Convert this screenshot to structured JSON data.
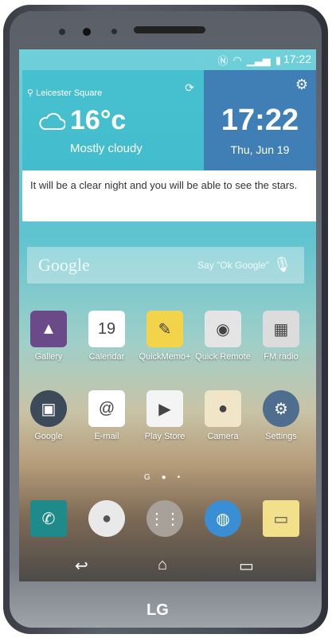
{
  "status": {
    "time": "17:22"
  },
  "weather": {
    "location": "Leicester Square",
    "temperature": "16°c",
    "condition": "Mostly cloudy"
  },
  "clock_widget": {
    "time": "17:22",
    "date": "Thu, Jun 19"
  },
  "notification": {
    "text": "It will be a clear night and you will be able to see the stars."
  },
  "search": {
    "logo": "Google",
    "hint": "Say \"Ok Google\""
  },
  "apps_row1": [
    {
      "label": "Gallery",
      "icon": "gallery-icon",
      "glyph": "▲",
      "bg": "#6b4a8a"
    },
    {
      "label": "Calendar",
      "icon": "calendar-icon",
      "glyph": "19",
      "bg": "#ffffff"
    },
    {
      "label": "QuickMemo+",
      "icon": "quickmemo-icon",
      "glyph": "✎",
      "bg": "#f3d34a"
    },
    {
      "label": "Quick Remote",
      "icon": "remote-icon",
      "glyph": "◉",
      "bg": "#e4e4e4"
    },
    {
      "label": "FM radio",
      "icon": "radio-icon",
      "glyph": "▦",
      "bg": "#dcdcdc"
    }
  ],
  "apps_row2": [
    {
      "label": "Google",
      "icon": "google-folder-icon",
      "glyph": "▣",
      "bg": "#3c4a5a"
    },
    {
      "label": "E-mail",
      "icon": "email-icon",
      "glyph": "@",
      "bg": "#ffffff"
    },
    {
      "label": "Play Store",
      "icon": "play-store-icon",
      "glyph": "▶",
      "bg": "#f4f4f4"
    },
    {
      "label": "Camera",
      "icon": "camera-icon",
      "glyph": "●",
      "bg": "#f1e5c8"
    },
    {
      "label": "Settings",
      "icon": "settings-icon",
      "glyph": "⚙",
      "bg": "#4f6d8f"
    }
  ],
  "dock": [
    {
      "icon": "phone-icon",
      "glyph": "✆",
      "bg": "#1e8a8a"
    },
    {
      "icon": "contacts-icon",
      "glyph": "●",
      "bg": "#e9e9e9"
    },
    {
      "icon": "apps-icon",
      "glyph": "⋮⋮",
      "bg": "#a7a19a"
    },
    {
      "icon": "browser-icon",
      "glyph": "◍",
      "bg": "#3a8fd4"
    },
    {
      "icon": "messages-icon",
      "glyph": "▭",
      "bg": "#f2e08a"
    }
  ],
  "brand": "LG"
}
